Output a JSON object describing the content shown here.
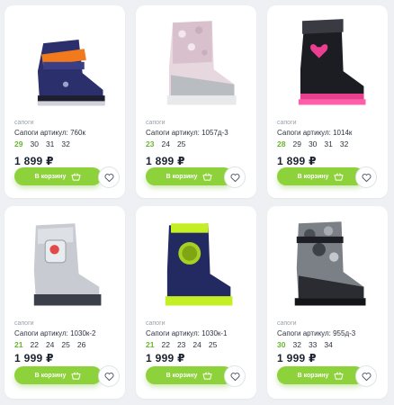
{
  "cart_label": "В корзину",
  "products": [
    {
      "category": "сапоги",
      "title": "Сапоги артикул: 760к",
      "sizes": [
        "29",
        "30",
        "31",
        "32"
      ],
      "price": "1 899 ₽",
      "image": "boot-navy-orange-icon"
    },
    {
      "category": "сапоги",
      "title": "Сапоги артикул: 1057д-3",
      "sizes": [
        "23",
        "24",
        "25"
      ],
      "price": "1 899 ₽",
      "image": "boot-pink-grey-icon"
    },
    {
      "category": "сапоги",
      "title": "Сапоги артикул: 1014к",
      "sizes": [
        "28",
        "29",
        "30",
        "31",
        "32"
      ],
      "price": "1 899 ₽",
      "image": "boot-black-pink-heart-icon"
    },
    {
      "category": "сапоги",
      "title": "Сапоги артикул: 1030к-2",
      "sizes": [
        "21",
        "22",
        "24",
        "25",
        "26"
      ],
      "price": "1 999 ₽",
      "image": "boot-silver-icon"
    },
    {
      "category": "сапоги",
      "title": "Сапоги артикул: 1030к-1",
      "sizes": [
        "21",
        "22",
        "23",
        "24",
        "25"
      ],
      "price": "1 999 ₽",
      "image": "boot-navy-lime-icon"
    },
    {
      "category": "сапоги",
      "title": "Сапоги артикул: 955д-3",
      "sizes": [
        "30",
        "32",
        "33",
        "34"
      ],
      "price": "1 999 ₽",
      "image": "boot-black-camo-icon"
    }
  ],
  "colors": {
    "accent": "#8dd13b",
    "size_highlight": "#67b52f",
    "background": "#eef0f3"
  }
}
